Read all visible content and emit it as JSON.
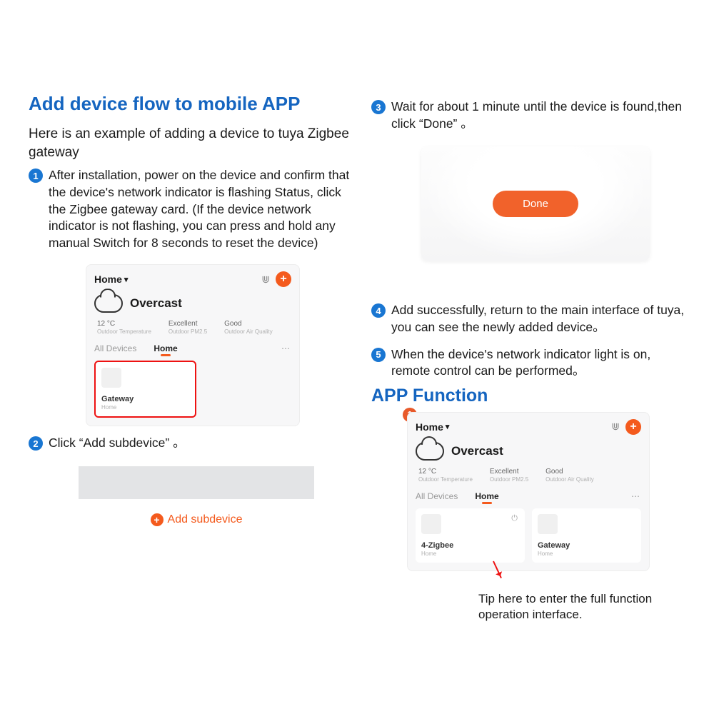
{
  "title": "Add device flow to mobile APP",
  "intro": "Here is an example of adding a device to tuya Zigbee gateway",
  "steps": {
    "s1": "After installation, power on the device and confirm that the device's network indicator is flashing Status, click the Zigbee gateway card. (If the device network indicator is not flashing, you can press and hold any manual Switch for 8 seconds to reset the device)",
    "s2": "Click “Add subdevice” 。",
    "s3": "Wait for about 1 minute until the device is found,then click “Done” 。",
    "s4": "Add successfully, return to the main interface of tuya, you can see the newly added device。",
    "s5": "When the device's network indicator light is on, remote control can be performed。"
  },
  "bullets": {
    "b1": "1",
    "b2": "2",
    "b3": "3",
    "b4": "4",
    "b5": "5",
    "r1": "1"
  },
  "app": {
    "home": "Home",
    "weather": "Overcast",
    "stat1_top": "12 °C",
    "stat1_sub": "Outdoor Temperature",
    "stat2_top": "Excellent",
    "stat2_sub": "Outdoor PM2.5",
    "stat3_top": "Good",
    "stat3_sub": "Outdoor Air Quality",
    "tab_all": "All Devices",
    "tab_home": "Home",
    "gateway": "Gateway",
    "gateway_sub": "Home",
    "zigbee": "4-Zigbee",
    "zigbee_sub": "Home"
  },
  "add_subdevice": "Add subdevice",
  "done": "Done",
  "section2": "APP Function",
  "tip": "Tip here to enter the full function operation interface."
}
